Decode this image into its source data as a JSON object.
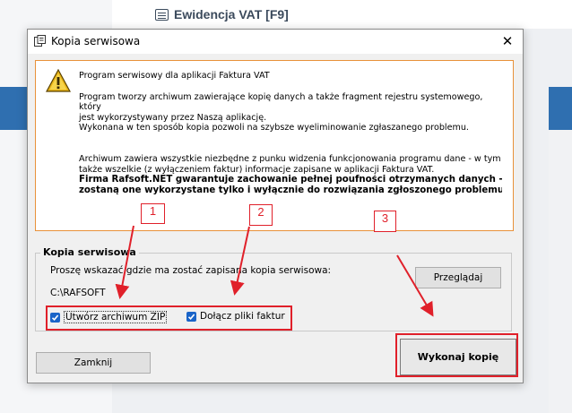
{
  "background": {
    "title": "Ewidencja VAT [F9]"
  },
  "dialog": {
    "title": "Kopia serwisowa",
    "close_glyph": "✕",
    "info": {
      "line1": "Program serwisowy dla aplikacji Faktura VAT",
      "line2": "Program tworzy archiwum zawierające kopię danych a także fragment rejestru systemowego, który",
      "line3": "jest wykorzystywany przez Naszą aplikację.",
      "line4": "Wykonana w ten sposób kopia pozwoli na szybsze wyeliminowanie zgłaszanego problemu.",
      "line5": "Archiwum zawiera wszystkie niezbędne z punku widzenia funkcjonowania programu dane - w tym",
      "line6": "także wszelkie (z wyłączeniem faktur) informacje zapisane w aplikacji Faktura VAT.",
      "bold1": "Firma Rafsoft.NET gwarantuje zachowanie pełnej poufności otrzymanych danych -",
      "bold2": "zostaną one wykorzystane tylko i wyłącznie do rozwiązania zgłoszonego problemu."
    },
    "group": {
      "legend": "Kopia serwisowa",
      "path_label": "Proszę wskazać gdzie ma zostać zapisana kopia serwisowa:",
      "path_value": "C:\\RAFSOFT",
      "browse_button": "Przeglądaj",
      "zip_checkbox": {
        "label": "Utwórz archiwum ZIP",
        "checked": true
      },
      "faktur_checkbox": {
        "label": "Dołącz pliki faktur",
        "checked": true
      }
    },
    "close_button": "Zamknij",
    "execute_button": "Wykonaj kopię"
  },
  "annotations": {
    "number1": "1",
    "number2": "2",
    "number3": "3",
    "color": "#e0202a"
  }
}
